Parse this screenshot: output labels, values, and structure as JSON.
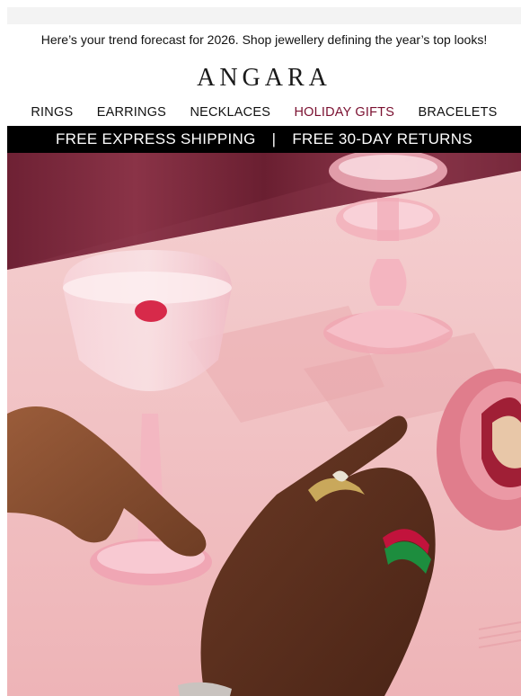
{
  "preheader": {
    "text": "Here’s your trend forecast for 2026. Shop jewellery defining the year’s top looks!"
  },
  "brand": {
    "logo": "ANGARA"
  },
  "nav": {
    "items": [
      {
        "label": "RINGS"
      },
      {
        "label": "EARRINGS"
      },
      {
        "label": "NECKLACES"
      },
      {
        "label": "HOLIDAY GIFTS"
      },
      {
        "label": "BRACELETS"
      }
    ]
  },
  "banner": {
    "left": "FREE EXPRESS SHIPPING",
    "separator": "|",
    "right": "FREE 30-DAY RETURNS"
  },
  "colors": {
    "accent": "#7a1030",
    "banner_bg": "#000000",
    "table_pink": "#f2c2c3",
    "curtain": "#7c2b3e"
  },
  "hero": {
    "image": "lifestyle-photo-rings-cocktail-glass"
  }
}
